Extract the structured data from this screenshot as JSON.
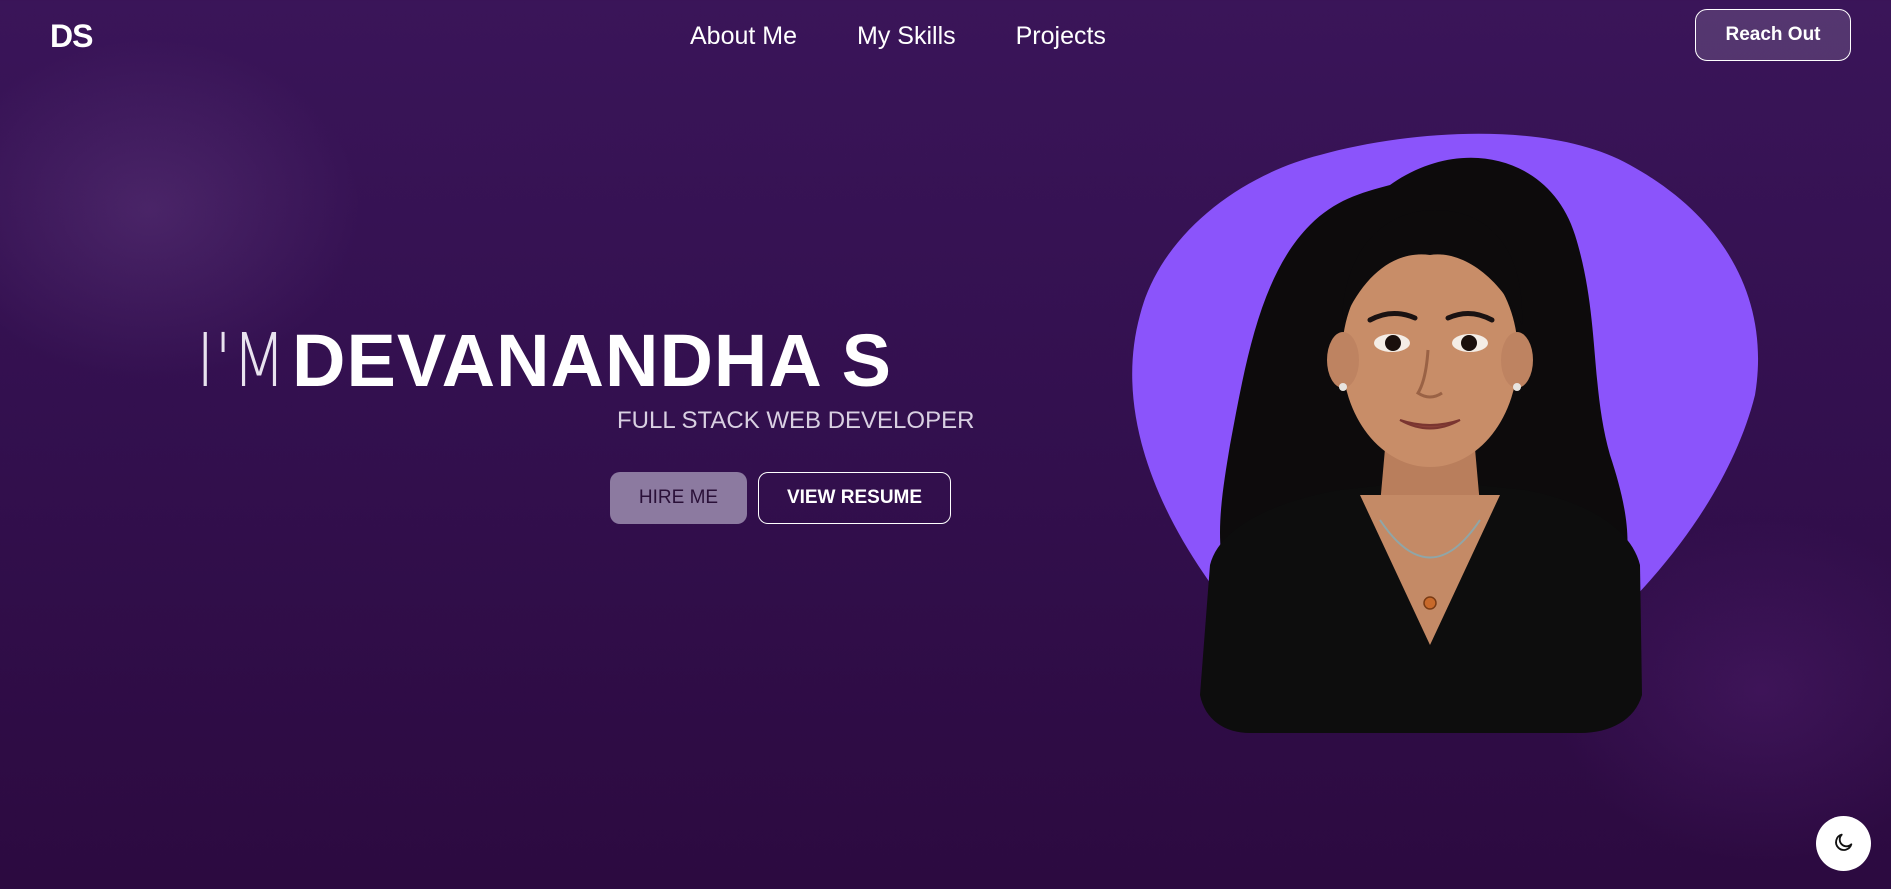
{
  "brand": {
    "logo": "DS"
  },
  "nav": {
    "items": [
      {
        "label": "About Me"
      },
      {
        "label": "My Skills"
      },
      {
        "label": "Projects"
      }
    ],
    "cta_label": "Reach Out"
  },
  "hero": {
    "prefix": "I'M",
    "name": "DEVANANDHA S",
    "subtitle": "FULL STACK WEB DEVELOPER",
    "hire_label": "HIRE ME",
    "resume_label": "VIEW RESUME"
  },
  "portrait": {
    "icon": "avatar-illustration",
    "blob_color": "#8b54fb"
  },
  "theme_toggle": {
    "icon": "moon-icon"
  },
  "colors": {
    "background_top": "#3a1559",
    "background_bottom": "#2c0a40",
    "accent": "#8b54fb",
    "hire_button": "#8c7aa0"
  }
}
